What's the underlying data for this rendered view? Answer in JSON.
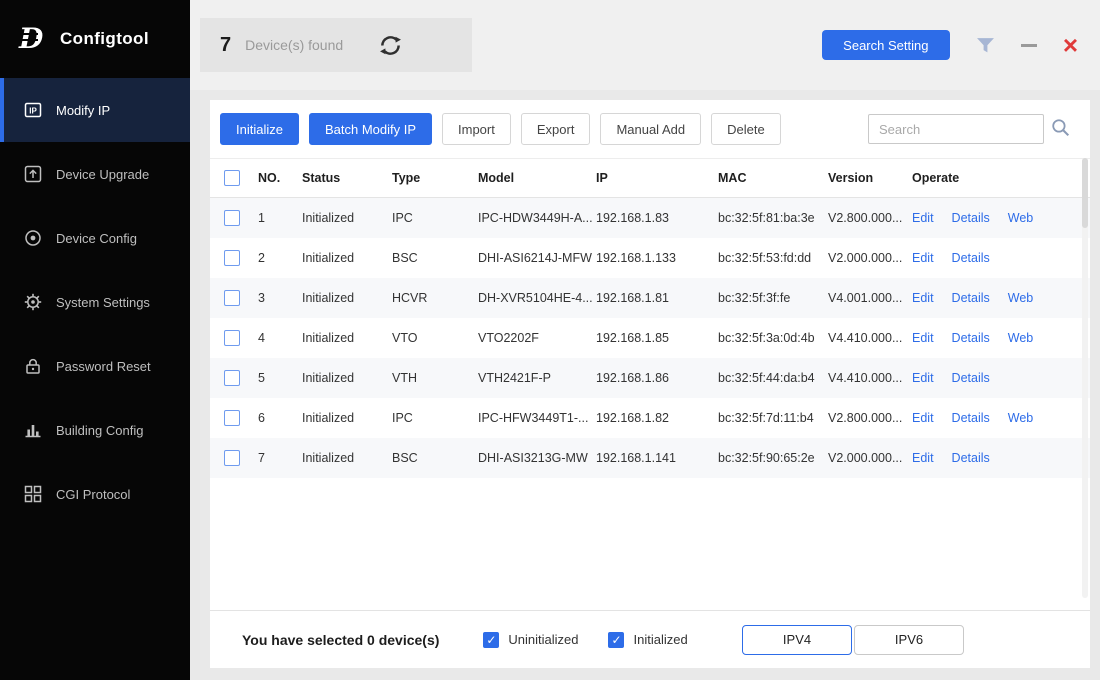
{
  "app": {
    "title": "Configtool"
  },
  "colors": {
    "accent_blue": "#2d6ce8",
    "close_red": "#e03a3a",
    "sidebar_active_bg": "#16233d"
  },
  "sidebar": {
    "items": [
      {
        "label": "Modify IP",
        "active": true
      },
      {
        "label": "Device Upgrade",
        "active": false
      },
      {
        "label": "Device Config",
        "active": false
      },
      {
        "label": "System Settings",
        "active": false
      },
      {
        "label": "Password Reset",
        "active": false
      },
      {
        "label": "Building Config",
        "active": false
      },
      {
        "label": "CGI Protocol",
        "active": false
      }
    ]
  },
  "topbar": {
    "device_count": "7",
    "devices_found_label": "Device(s) found",
    "search_setting_label": "Search Setting"
  },
  "toolbar": {
    "initialize": "Initialize",
    "batch_modify_ip": "Batch Modify IP",
    "import": "Import",
    "export": "Export",
    "manual_add": "Manual Add",
    "delete": "Delete",
    "search_placeholder": "Search"
  },
  "table": {
    "headers": [
      "NO.",
      "Status",
      "Type",
      "Model",
      "IP",
      "MAC",
      "Version",
      "Operate"
    ],
    "rows": [
      {
        "no": "1",
        "status": "Initialized",
        "type": "IPC",
        "model": "IPC-HDW3449H-A...",
        "ip": "192.168.1.83",
        "mac": "bc:32:5f:81:ba:3e",
        "version": "V2.800.000...",
        "ops": [
          "Edit",
          "Details",
          "Web"
        ]
      },
      {
        "no": "2",
        "status": "Initialized",
        "type": "BSC",
        "model": "DHI-ASI6214J-MFW",
        "ip": "192.168.1.133",
        "mac": "bc:32:5f:53:fd:dd",
        "version": "V2.000.000...",
        "ops": [
          "Edit",
          "Details"
        ]
      },
      {
        "no": "3",
        "status": "Initialized",
        "type": "HCVR",
        "model": "DH-XVR5104HE-4...",
        "ip": "192.168.1.81",
        "mac": "bc:32:5f:3f:fe",
        "version": "V4.001.000...",
        "ops": [
          "Edit",
          "Details",
          "Web"
        ]
      },
      {
        "no": "4",
        "status": "Initialized",
        "type": "VTO",
        "model": "VTO2202F",
        "ip": "192.168.1.85",
        "mac": "bc:32:5f:3a:0d:4b",
        "version": "V4.410.000...",
        "ops": [
          "Edit",
          "Details",
          "Web"
        ]
      },
      {
        "no": "5",
        "status": "Initialized",
        "type": "VTH",
        "model": "VTH2421F-P",
        "ip": "192.168.1.86",
        "mac": "bc:32:5f:44:da:b4",
        "version": "V4.410.000...",
        "ops": [
          "Edit",
          "Details"
        ]
      },
      {
        "no": "6",
        "status": "Initialized",
        "type": "IPC",
        "model": "IPC-HFW3449T1-...",
        "ip": "192.168.1.82",
        "mac": "bc:32:5f:7d:11:b4",
        "version": "V2.800.000...",
        "ops": [
          "Edit",
          "Details",
          "Web"
        ]
      },
      {
        "no": "7",
        "status": "Initialized",
        "type": "BSC",
        "model": "DHI-ASI3213G-MW",
        "ip": "192.168.1.141",
        "mac": "bc:32:5f:90:65:2e",
        "version": "V2.000.000...",
        "ops": [
          "Edit",
          "Details"
        ]
      }
    ]
  },
  "footer": {
    "selected_text": "You have selected 0  device(s)",
    "uninitialized_label": "Uninitialized",
    "initialized_label": "Initialized",
    "ipv4_label": "IPV4",
    "ipv6_label": "IPV6"
  }
}
